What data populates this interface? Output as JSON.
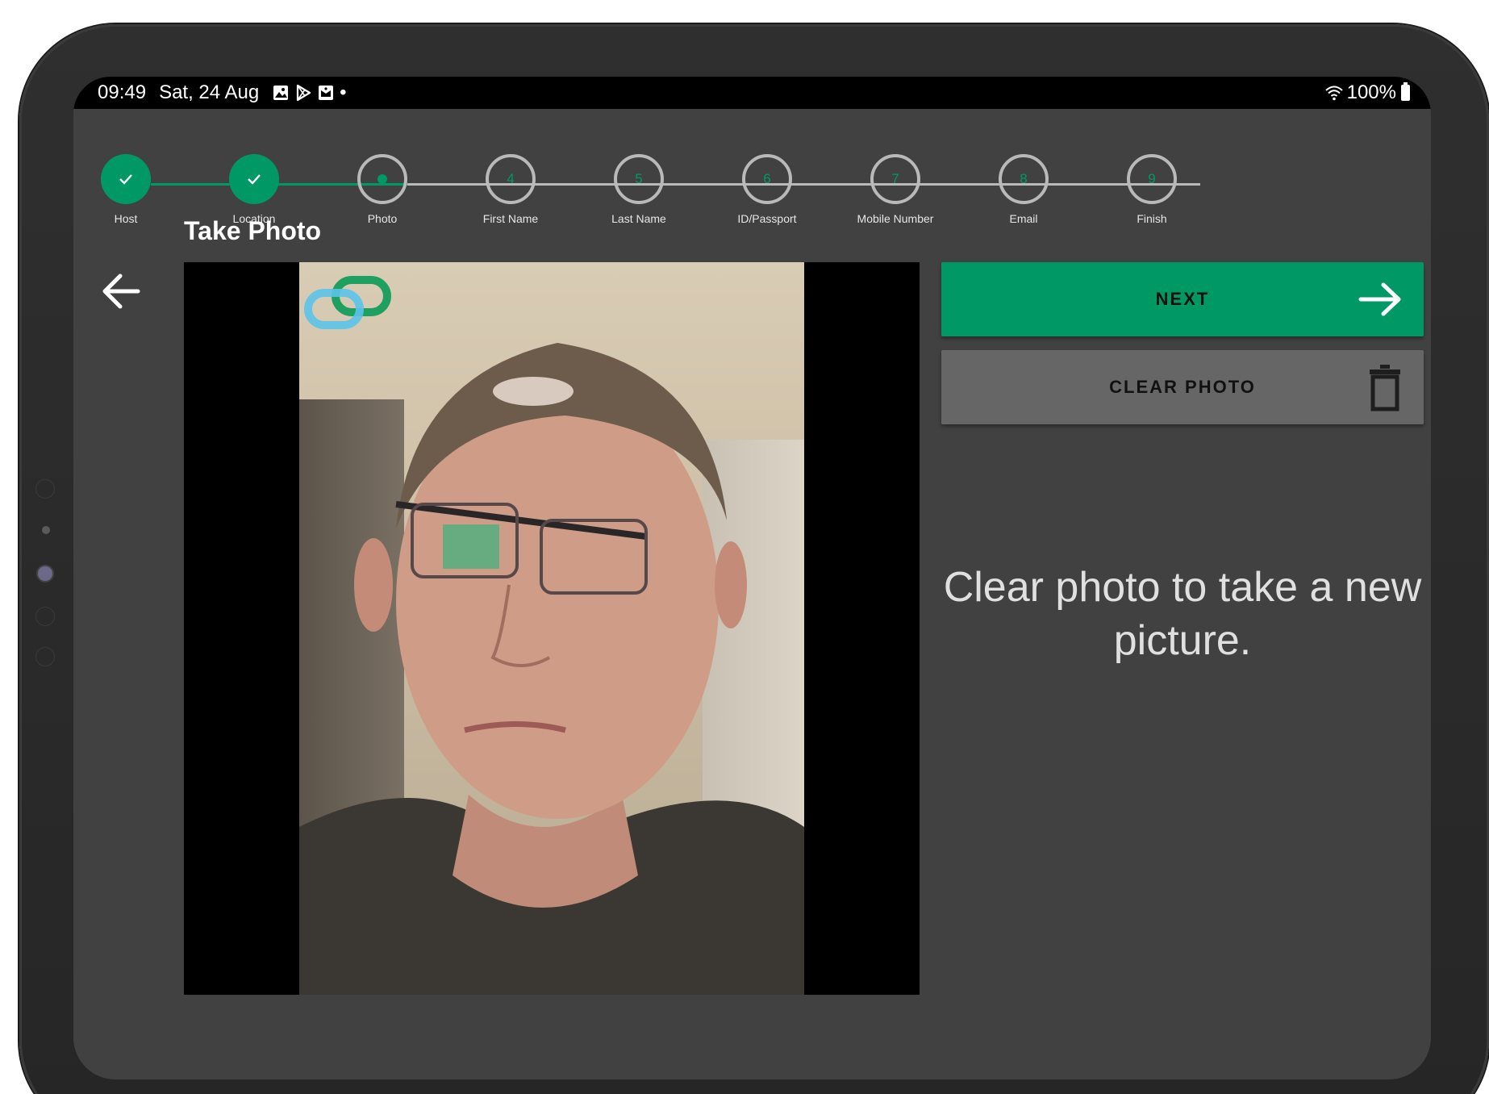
{
  "status_bar": {
    "time": "09:49",
    "date": "Sat, 24 Aug",
    "dot": "•",
    "battery": "100%",
    "icons": [
      "gallery-icon",
      "play-store-icon",
      "mail-icon",
      "wifi-icon",
      "battery-icon"
    ]
  },
  "stepper": {
    "steps": [
      {
        "label": "Host",
        "number": "",
        "state": "done"
      },
      {
        "label": "Location",
        "number": "",
        "state": "done"
      },
      {
        "label": "Photo",
        "number": "",
        "state": "active"
      },
      {
        "label": "First Name",
        "number": "4",
        "state": "todo"
      },
      {
        "label": "Last Name",
        "number": "5",
        "state": "todo"
      },
      {
        "label": "ID/Passport",
        "number": "6",
        "state": "todo"
      },
      {
        "label": "Mobile Number",
        "number": "7",
        "state": "todo"
      },
      {
        "label": "Email",
        "number": "8",
        "state": "todo"
      },
      {
        "label": "Finish",
        "number": "9",
        "state": "todo"
      }
    ]
  },
  "page": {
    "title": "Take Photo"
  },
  "actions": {
    "next_label": "NEXT",
    "clear_label": "CLEAR PHOTO"
  },
  "hint": {
    "text": "Clear photo to take a new picture."
  },
  "colors": {
    "accent": "#009966",
    "screen_bg": "#414141",
    "clear_button": "#666666",
    "pending_step": "#b9b9b9"
  }
}
